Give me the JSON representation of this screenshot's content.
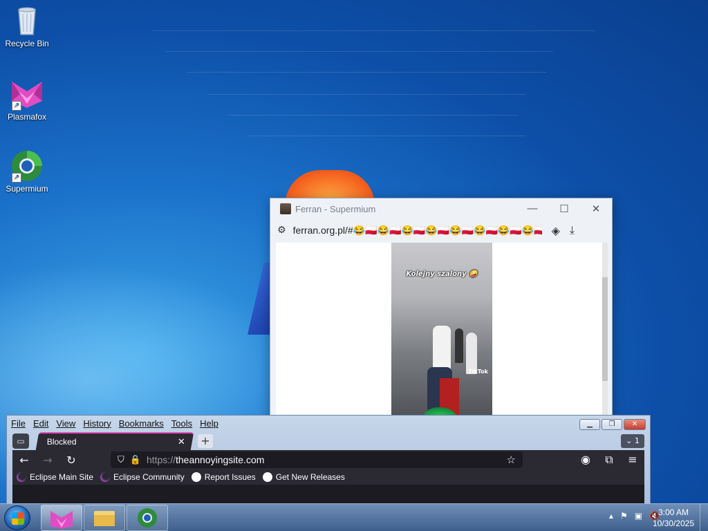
{
  "desktop": {
    "icons": [
      {
        "label": "Recycle Bin",
        "icon": "recycle-bin-icon"
      },
      {
        "label": "Plasmafox",
        "icon": "plasmafox-icon"
      },
      {
        "label": "Supermium",
        "icon": "supermium-icon"
      }
    ]
  },
  "popup": {
    "title": "Ferran - Supermium",
    "url": "ferran.org.pl/#😂🇵🇱😂🇵🇱😂🇵🇱😂🇵🇱😂🇵🇱😂🇵🇱😂🇵🇱😂🇵🇱😂",
    "video_caption": "Kolejny szalony 🤪",
    "video_watermark": "TikTok",
    "controls": {
      "minimize": "—",
      "maximize": "☐",
      "close": "✕"
    }
  },
  "plasmafox": {
    "menu": [
      "File",
      "Edit",
      "View",
      "History",
      "Bookmarks",
      "Tools",
      "Help"
    ],
    "tab": {
      "title": "Blocked",
      "close": "✕"
    },
    "new_tab": "+",
    "tab_count": "1",
    "url_scheme": "https://",
    "url_host": "theannoyingsite.com",
    "bookmarks": [
      {
        "label": "Eclipse Main Site",
        "icon": "eclipse-icon"
      },
      {
        "label": "Eclipse Community",
        "icon": "eclipse-icon"
      },
      {
        "label": "Report Issues",
        "icon": "github-icon"
      },
      {
        "label": "Get New Releases",
        "icon": "github-icon"
      }
    ]
  },
  "taskbar": {
    "time": "3:00 AM",
    "date": "10/30/2025",
    "apps": [
      "Plasmafox",
      "Windows Explorer",
      "Supermium"
    ]
  }
}
